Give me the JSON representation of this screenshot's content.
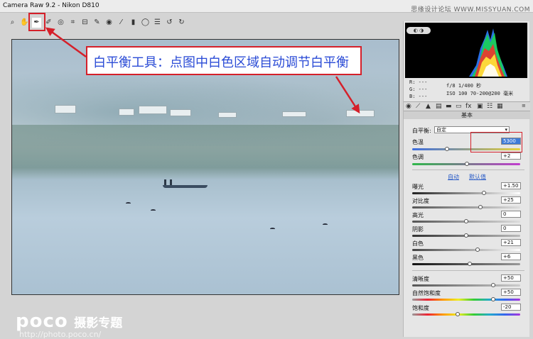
{
  "window": {
    "title": "Camera Raw 9.2 -  Nikon D810",
    "watermark": "思缘设计论坛  WWW.MISSYUAN.COM"
  },
  "toolbar": {
    "tools": [
      {
        "name": "zoom-tool-icon",
        "glyph": "🔍"
      },
      {
        "name": "hand-tool-icon",
        "glyph": "✋"
      },
      {
        "name": "white-balance-tool-icon",
        "glyph": "✒"
      },
      {
        "name": "color-sampler-tool-icon",
        "glyph": "✦"
      },
      {
        "name": "crop-tool-icon",
        "glyph": "⌗"
      },
      {
        "name": "straighten-tool-icon",
        "glyph": "⊟"
      },
      {
        "name": "spot-removal-tool-icon",
        "glyph": "✎"
      },
      {
        "name": "red-eye-tool-icon",
        "glyph": "◉"
      },
      {
        "name": "adjustment-brush-icon",
        "glyph": "⁄"
      },
      {
        "name": "graduated-filter-icon",
        "glyph": "▮"
      },
      {
        "name": "radial-filter-icon",
        "glyph": "◯"
      },
      {
        "name": "preferences-icon",
        "glyph": "☰"
      },
      {
        "name": "rotate-left-icon",
        "glyph": "↺"
      },
      {
        "name": "rotate-right-icon",
        "glyph": "↻"
      }
    ]
  },
  "callout": {
    "text": "白平衡工具：点图中白色区域自动调节白平衡"
  },
  "logo": {
    "mark": "poco",
    "brand": "摄影专题",
    "url": "http://photo.poco.cn/"
  },
  "info": {
    "r": "R:  ---",
    "g": "G:  ---",
    "b": "B:  ---",
    "aperture_shutter": "f/8   1/400 秒",
    "iso_lens": "ISO 100   70-200@200 毫米"
  },
  "panel": {
    "section_title": "基本",
    "white_balance_label": "白平衡:",
    "white_balance_value": "自定",
    "temperature_label": "色温",
    "temperature_value": "5300",
    "tint_label": "色调",
    "tint_value": "+2",
    "auto_link": "自动",
    "default_link": "默认值",
    "exposure_label": "曝光",
    "exposure_value": "+1.50",
    "contrast_label": "对比度",
    "contrast_value": "+25",
    "highlights_label": "高光",
    "highlights_value": "0",
    "shadows_label": "阴影",
    "shadows_value": "0",
    "whites_label": "白色",
    "whites_value": "+21",
    "blacks_label": "黑色",
    "blacks_value": "+6",
    "clarity_label": "清晰度",
    "clarity_value": "+50",
    "vibrance_label": "自然饱和度",
    "vibrance_value": "+50",
    "saturation_label": "饱和度",
    "saturation_value": "-20"
  },
  "colors": {
    "accent_red": "#d5202a",
    "callout_text": "#2a4bd6"
  }
}
